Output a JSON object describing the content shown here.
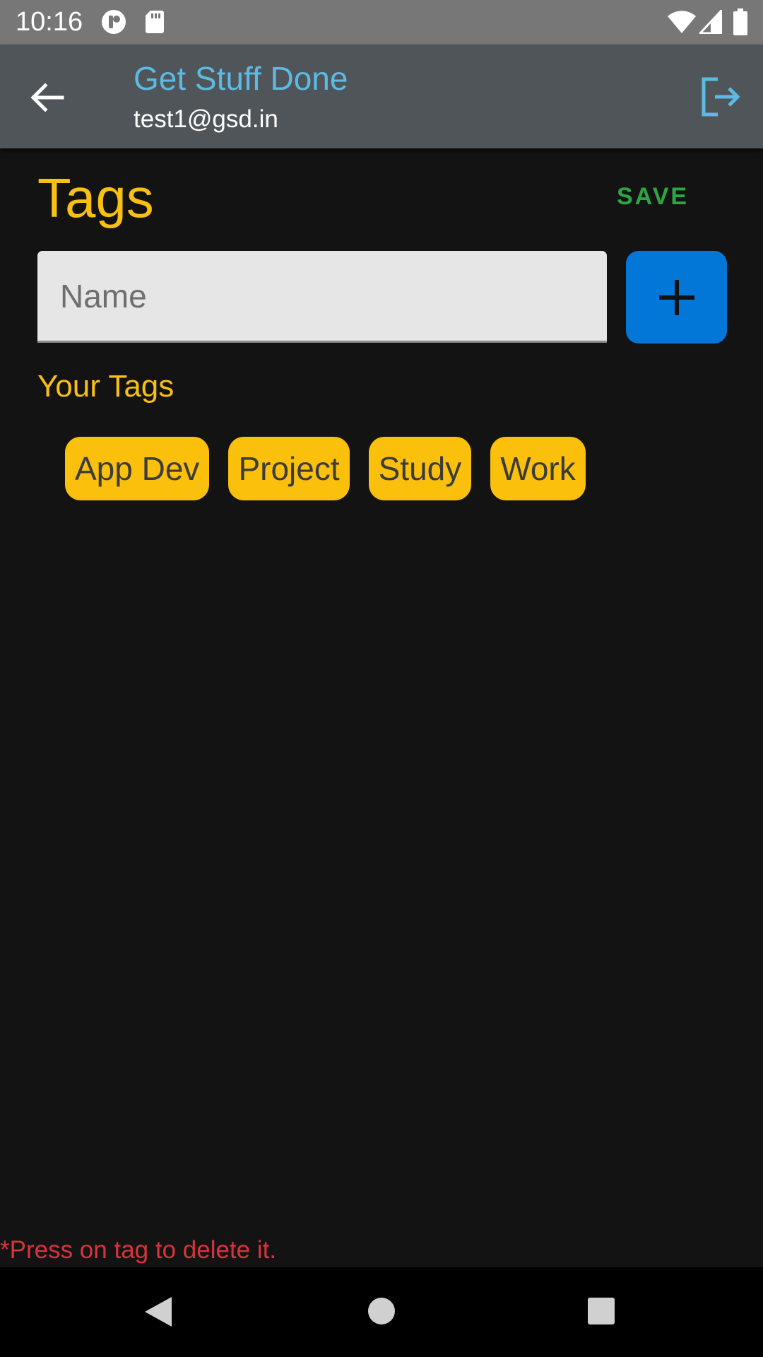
{
  "status_bar": {
    "time": "10:16",
    "icons": [
      "app-notification-icon",
      "sd-card-icon",
      "wifi-icon",
      "cellular-signal-icon",
      "battery-icon"
    ]
  },
  "app_bar": {
    "title": "Get Stuff Done",
    "user_email": "test1@gsd.in",
    "back_icon": "arrow-back-icon",
    "logout_icon": "logout-icon",
    "title_color": "#5bbbe3",
    "background_color": "#50555a"
  },
  "page": {
    "title": "Tags",
    "save_label": "SAVE",
    "name_input": {
      "value": "",
      "placeholder": "Name"
    },
    "add_button_icon": "plus-icon",
    "section_label": "Your Tags",
    "tags": [
      {
        "label": "App Dev"
      },
      {
        "label": "Project"
      },
      {
        "label": "Study"
      },
      {
        "label": "Work"
      }
    ],
    "hint": "*Press on tag to delete it."
  },
  "colors": {
    "accent_yellow": "#f8c014",
    "save_green": "#2ea545",
    "add_button_blue": "#0277d8",
    "hint_red": "#d9343d",
    "background": "#131313"
  },
  "nav_bar": {
    "icons": [
      "nav-back-icon",
      "nav-home-icon",
      "nav-recents-icon"
    ]
  }
}
